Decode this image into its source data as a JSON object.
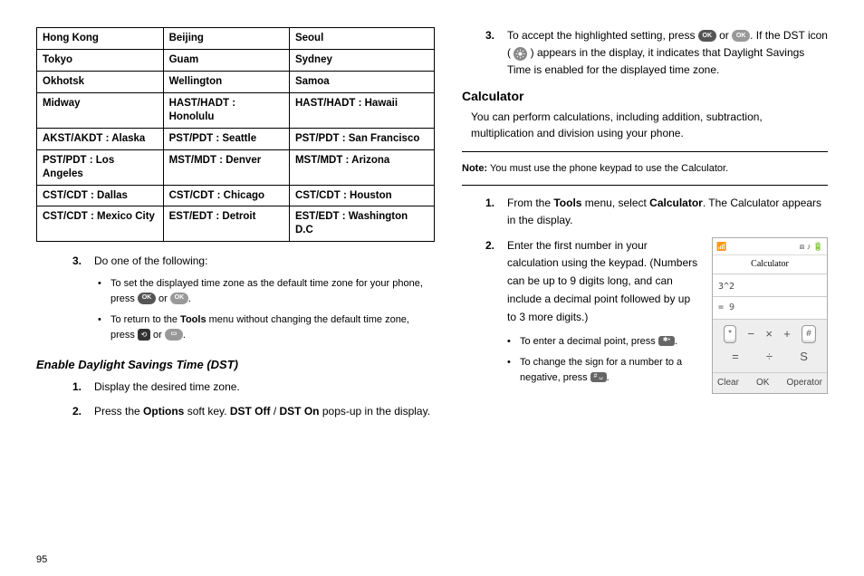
{
  "page_number": "95",
  "timezone_table": [
    [
      "Hong Kong",
      "Beijing",
      "Seoul"
    ],
    [
      "Tokyo",
      "Guam",
      "Sydney"
    ],
    [
      "Okhotsk",
      "Wellington",
      "Samoa"
    ],
    [
      "Midway",
      "HAST/HADT : Honolulu",
      "HAST/HADT : Hawaii"
    ],
    [
      "AKST/AKDT : Alaska",
      "PST/PDT : Seattle",
      "PST/PDT : San Francisco"
    ],
    [
      "PST/PDT : Los Angeles",
      "MST/MDT : Denver",
      "MST/MDT : Arizona"
    ],
    [
      "CST/CDT : Dallas",
      "CST/CDT : Chicago",
      "CST/CDT : Houston"
    ],
    [
      "CST/CDT : Mexico City",
      "EST/EDT : Detroit",
      "EST/EDT : Washington D.C"
    ]
  ],
  "left": {
    "step3": {
      "num": "3.",
      "lead": "Do one of the following:",
      "bullets": {
        "b1": {
          "pre": "To set the displayed time zone as the default time zone for your phone, press ",
          "or": " or ",
          "post": "."
        },
        "b2": {
          "pre": "To return to the ",
          "tools": "Tools",
          "mid": " menu without changing the default time zone, press ",
          "or": " or ",
          "post": "."
        }
      }
    },
    "dst_heading": "Enable Daylight Savings Time (DST)",
    "dst_step1": {
      "num": "1.",
      "text": "Display the desired time zone."
    },
    "dst_step2": {
      "num": "2.",
      "pre": "Press the ",
      "options": "Options",
      "mid": " soft key. ",
      "dstoff": "DST Off",
      "slash": " / ",
      "dston": "DST On",
      "post": " pops-up in the display."
    }
  },
  "right": {
    "step3": {
      "num": "3.",
      "pre": "To accept the highlighted setting, press ",
      "or": " or ",
      "mid": ". If the DST icon ( ",
      "mid2": " ) appears in the display, it indicates that Daylight Savings Time is enabled for the displayed time zone."
    },
    "calc_heading": "Calculator",
    "calc_intro": "You can perform calculations, including addition, subtraction, multiplication and division using your phone.",
    "note_label": "Note:",
    "note_text": " You must use the phone keypad to use the Calculator.",
    "step1": {
      "num": "1.",
      "pre": "From the ",
      "tools": "Tools",
      "mid": " menu, select ",
      "calc": "Calculator",
      "post": ". The Calculator appears in the display."
    },
    "step2": {
      "num": "2.",
      "text": "Enter the first number in your calculation using the keypad. (Numbers can be up to 9 digits long, and can include a decimal point followed by up to 3 more digits.)",
      "bullets": {
        "b1": {
          "pre": "To enter a decimal point, press ",
          "post": "."
        },
        "b2": {
          "pre": "To change the sign for a number to a negative, press ",
          "post": "."
        }
      }
    },
    "calc_img": {
      "title": "Calculator",
      "expr": "3^2",
      "result": "= 9",
      "key_star": "*",
      "key_hash": "#",
      "soft_left": "Clear",
      "soft_mid": "OK",
      "soft_right": "Operator",
      "op_minus": "−",
      "op_times": "×",
      "op_plus": "+",
      "op_equals": "=",
      "op_div": "÷",
      "op_s": "S"
    }
  },
  "icons": {
    "ok_small": "OK",
    "ok_wide": "OK"
  }
}
